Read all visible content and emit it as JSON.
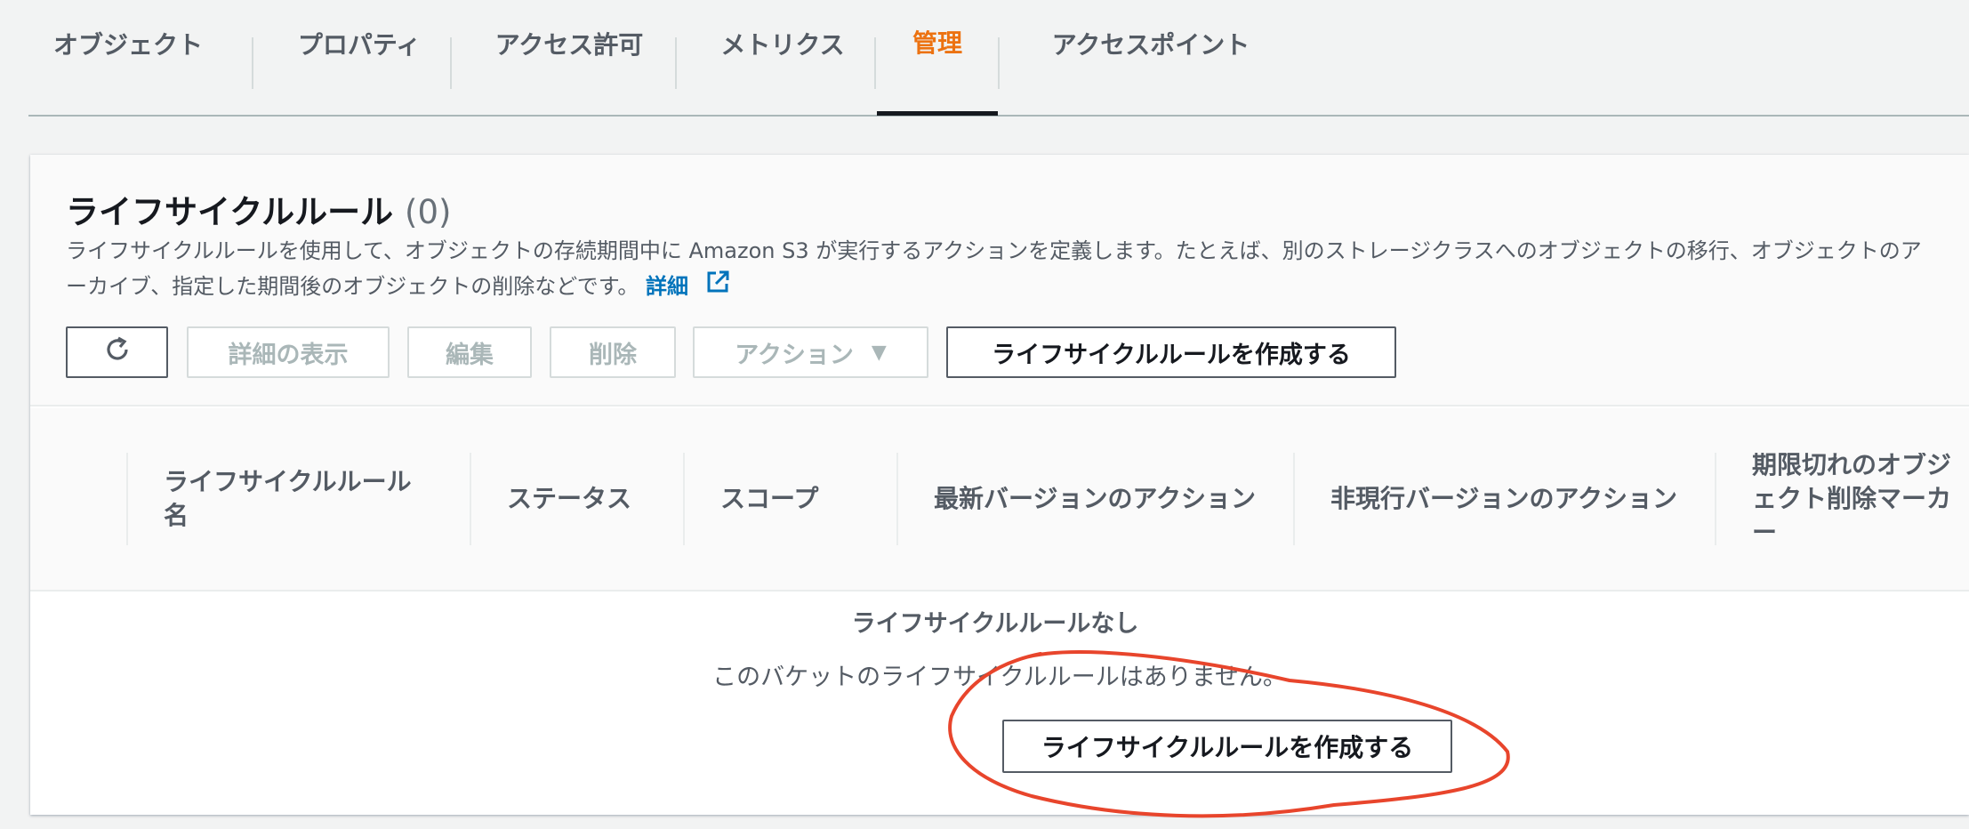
{
  "tabs": [
    {
      "label": "オブジェクト",
      "active": false
    },
    {
      "label": "プロパティ",
      "active": false
    },
    {
      "label": "アクセス許可",
      "active": false
    },
    {
      "label": "メトリクス",
      "active": false
    },
    {
      "label": "管理",
      "active": true
    },
    {
      "label": "アクセスポイント",
      "active": false
    }
  ],
  "panel": {
    "title": "ライフサイクルルール",
    "count": "(0)",
    "description": "ライフサイクルルールを使用して、オブジェクトの存続期間中に Amazon S3 が実行するアクションを定義します。たとえば、別のストレージクラスへのオブジェクトの移行、オブジェクトのアーカイブ、指定した期間後のオブジェクトの削除などです。",
    "learn_more": "詳細"
  },
  "toolbar": {
    "refresh_icon": "refresh-icon",
    "view_details": "詳細の表示",
    "edit": "編集",
    "delete": "削除",
    "actions": "アクション",
    "actions_caret": "▼",
    "create": "ライフサイクルルールを作成する"
  },
  "table": {
    "columns": [
      "ライフサイクルルール\n名",
      "ステータス",
      "スコープ",
      "最新バージョンのアクション",
      "非現行バージョンのアクション",
      "期限切れのオブジェクト削除マーカー"
    ]
  },
  "empty_state": {
    "title": "ライフサイクルルールなし",
    "description": "このバケットのライフサイクルルールはありません。",
    "create": "ライフサイクルルールを作成する"
  },
  "colors": {
    "active_tab": "#ec7211",
    "link": "#0073bb",
    "annotation": "#e8452c"
  }
}
